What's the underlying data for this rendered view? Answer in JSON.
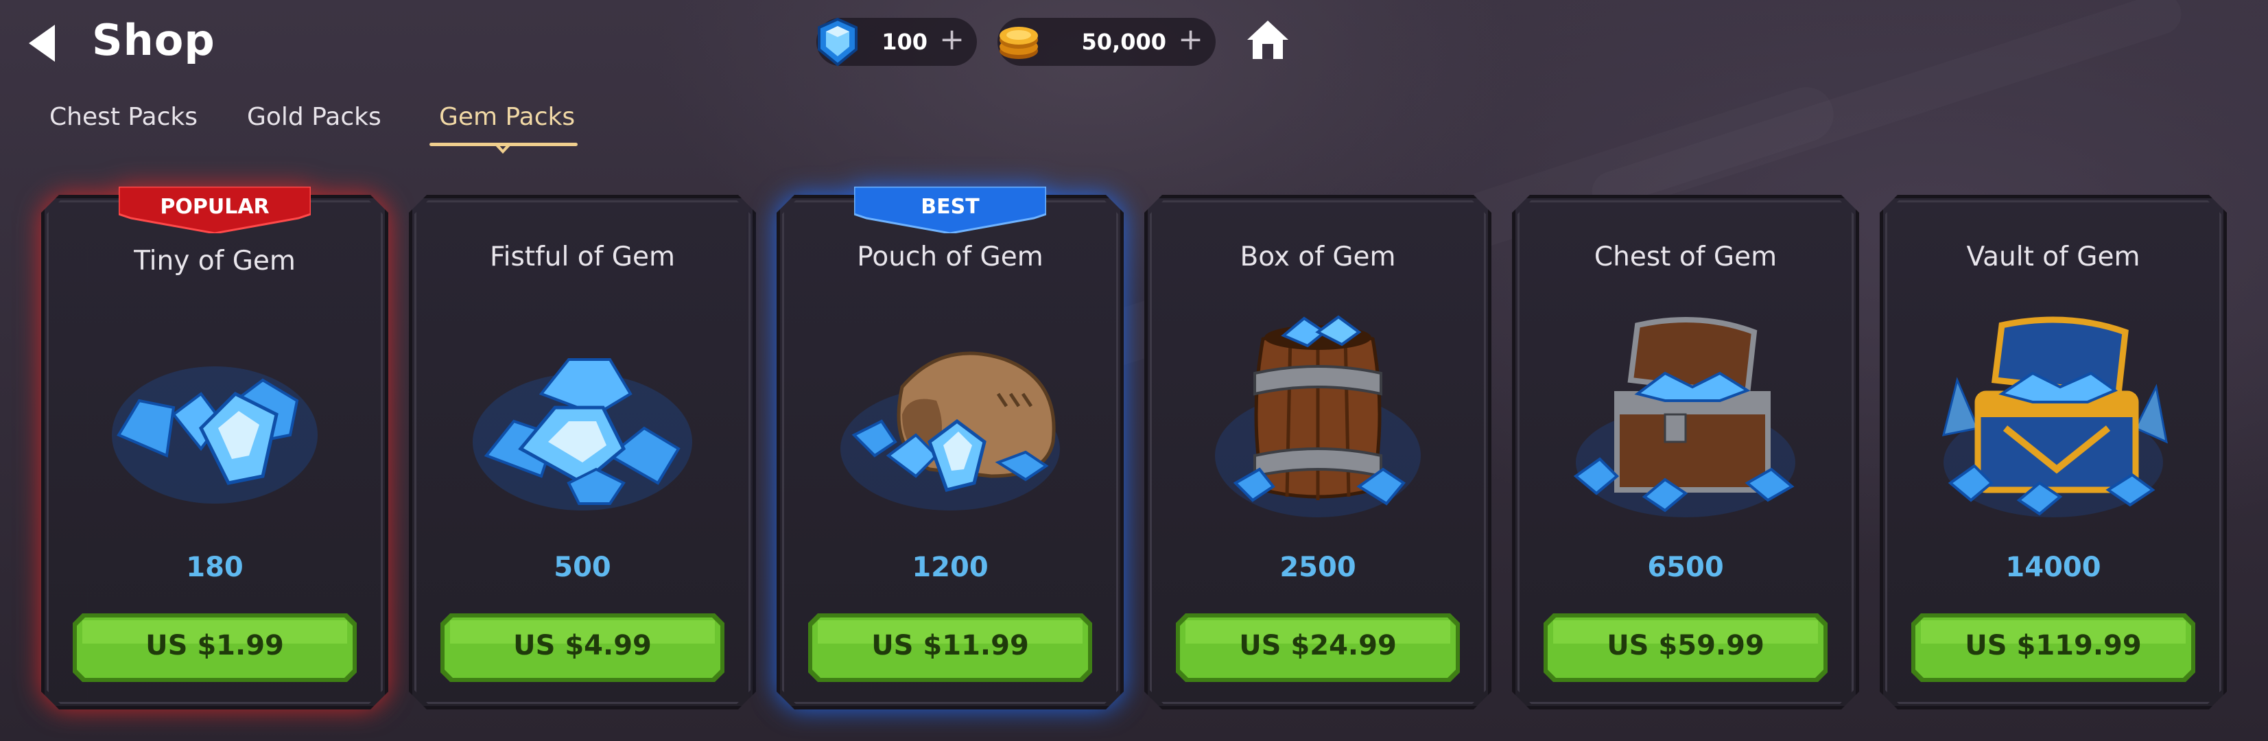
{
  "header": {
    "title": "Shop"
  },
  "currencies": {
    "gems": "100",
    "gold": "50,000",
    "plus": "+"
  },
  "tabs": {
    "chest": "Chest Packs",
    "gold": "Gold Packs",
    "gem": "Gem Packs",
    "active": "Gem Packs"
  },
  "packs": [
    {
      "name": "Tiny of Gem",
      "amount": "180",
      "price": "US $1.99",
      "tag": "POPULAR",
      "icon": "gem-handful-icon"
    },
    {
      "name": "Fistful of Gem",
      "amount": "500",
      "price": "US $4.99",
      "tag": "",
      "icon": "gem-pile-icon"
    },
    {
      "name": "Pouch of Gem",
      "amount": "1200",
      "price": "US $11.99",
      "tag": "BEST",
      "icon": "gem-pouch-icon"
    },
    {
      "name": "Box of Gem",
      "amount": "2500",
      "price": "US $24.99",
      "tag": "",
      "icon": "gem-barrel-icon"
    },
    {
      "name": "Chest of Gem",
      "amount": "6500",
      "price": "US $59.99",
      "tag": "",
      "icon": "gem-chest-icon"
    },
    {
      "name": "Vault of Gem",
      "amount": "14000",
      "price": "US $119.99",
      "tag": "",
      "icon": "gem-vault-icon"
    }
  ],
  "colors": {
    "amount": "#5fb9f0",
    "buy_button": "#6cc530",
    "popular_ribbon": "#c8151b",
    "best_ribbon": "#1f6fe6",
    "active_tab": "#f1d9a6"
  }
}
